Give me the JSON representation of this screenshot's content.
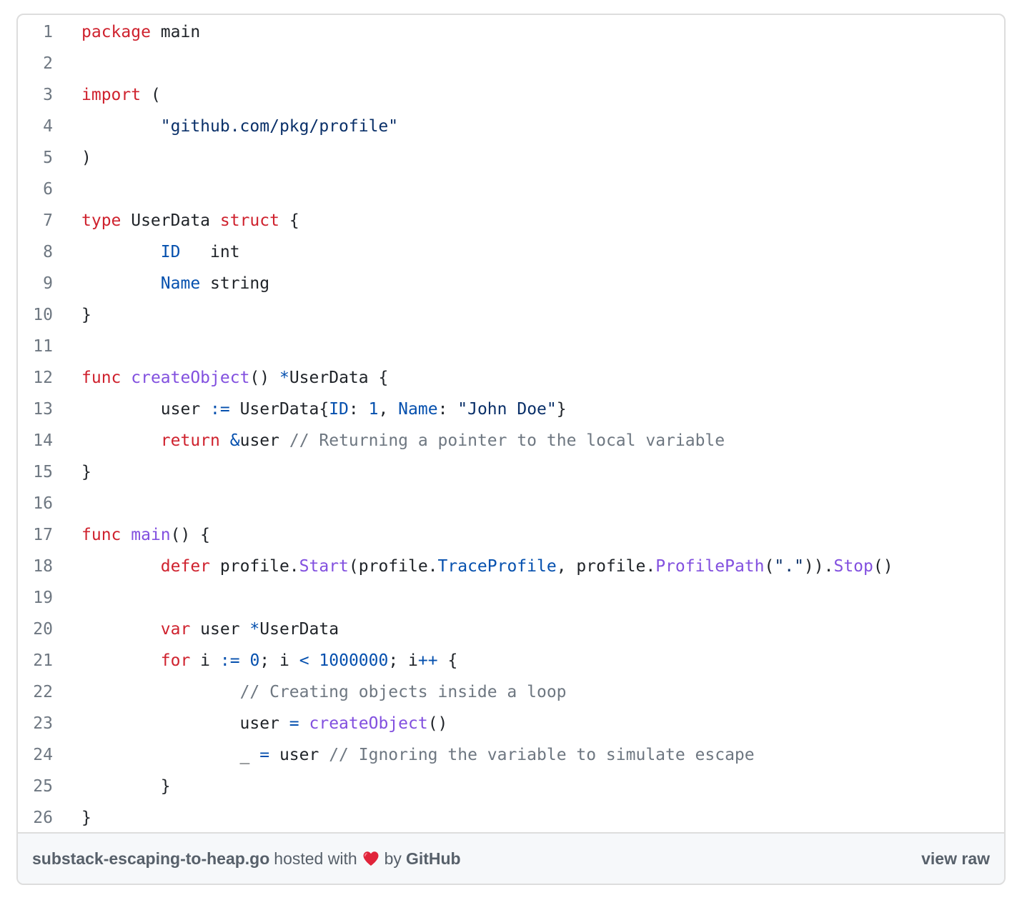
{
  "code": {
    "lines": [
      {
        "number": "1",
        "tokens": [
          {
            "t": "kw",
            "v": "package"
          },
          {
            "t": "tx",
            "v": " main"
          }
        ]
      },
      {
        "number": "2",
        "tokens": []
      },
      {
        "number": "3",
        "tokens": [
          {
            "t": "kw",
            "v": "import"
          },
          {
            "t": "tx",
            "v": " ("
          }
        ]
      },
      {
        "number": "4",
        "tokens": [
          {
            "t": "tx",
            "v": "        "
          },
          {
            "t": "st",
            "v": "\"github.com/pkg/profile\""
          }
        ]
      },
      {
        "number": "5",
        "tokens": [
          {
            "t": "tx",
            "v": ")"
          }
        ]
      },
      {
        "number": "6",
        "tokens": []
      },
      {
        "number": "7",
        "tokens": [
          {
            "t": "kw",
            "v": "type"
          },
          {
            "t": "tx",
            "v": " UserData "
          },
          {
            "t": "kw",
            "v": "struct"
          },
          {
            "t": "tx",
            "v": " {"
          }
        ]
      },
      {
        "number": "8",
        "tokens": [
          {
            "t": "tx",
            "v": "        "
          },
          {
            "t": "id",
            "v": "ID"
          },
          {
            "t": "tx",
            "v": "   int"
          }
        ]
      },
      {
        "number": "9",
        "tokens": [
          {
            "t": "tx",
            "v": "        "
          },
          {
            "t": "id",
            "v": "Name"
          },
          {
            "t": "tx",
            "v": " string"
          }
        ]
      },
      {
        "number": "10",
        "tokens": [
          {
            "t": "tx",
            "v": "}"
          }
        ]
      },
      {
        "number": "11",
        "tokens": []
      },
      {
        "number": "12",
        "tokens": [
          {
            "t": "kw",
            "v": "func"
          },
          {
            "t": "tx",
            "v": " "
          },
          {
            "t": "fn",
            "v": "createObject"
          },
          {
            "t": "tx",
            "v": "() "
          },
          {
            "t": "op",
            "v": "*"
          },
          {
            "t": "tx",
            "v": "UserData {"
          }
        ]
      },
      {
        "number": "13",
        "tokens": [
          {
            "t": "tx",
            "v": "        user "
          },
          {
            "t": "op",
            "v": ":="
          },
          {
            "t": "tx",
            "v": " UserData{"
          },
          {
            "t": "id",
            "v": "ID"
          },
          {
            "t": "tx",
            "v": ": "
          },
          {
            "t": "nm",
            "v": "1"
          },
          {
            "t": "tx",
            "v": ", "
          },
          {
            "t": "id",
            "v": "Name"
          },
          {
            "t": "tx",
            "v": ": "
          },
          {
            "t": "st",
            "v": "\"John Doe\""
          },
          {
            "t": "tx",
            "v": "}"
          }
        ]
      },
      {
        "number": "14",
        "tokens": [
          {
            "t": "tx",
            "v": "        "
          },
          {
            "t": "kw",
            "v": "return"
          },
          {
            "t": "tx",
            "v": " "
          },
          {
            "t": "op",
            "v": "&"
          },
          {
            "t": "tx",
            "v": "user "
          },
          {
            "t": "cm",
            "v": "// Returning a pointer to the local variable"
          }
        ]
      },
      {
        "number": "15",
        "tokens": [
          {
            "t": "tx",
            "v": "}"
          }
        ]
      },
      {
        "number": "16",
        "tokens": []
      },
      {
        "number": "17",
        "tokens": [
          {
            "t": "kw",
            "v": "func"
          },
          {
            "t": "tx",
            "v": " "
          },
          {
            "t": "fn",
            "v": "main"
          },
          {
            "t": "tx",
            "v": "() {"
          }
        ]
      },
      {
        "number": "18",
        "tokens": [
          {
            "t": "tx",
            "v": "        "
          },
          {
            "t": "kw",
            "v": "defer"
          },
          {
            "t": "tx",
            "v": " profile."
          },
          {
            "t": "fn",
            "v": "Start"
          },
          {
            "t": "tx",
            "v": "(profile."
          },
          {
            "t": "id",
            "v": "TraceProfile"
          },
          {
            "t": "tx",
            "v": ", profile."
          },
          {
            "t": "fn",
            "v": "ProfilePath"
          },
          {
            "t": "tx",
            "v": "("
          },
          {
            "t": "st",
            "v": "\".\""
          },
          {
            "t": "tx",
            "v": "))."
          },
          {
            "t": "fn",
            "v": "Stop"
          },
          {
            "t": "tx",
            "v": "()"
          }
        ]
      },
      {
        "number": "19",
        "tokens": []
      },
      {
        "number": "20",
        "tokens": [
          {
            "t": "tx",
            "v": "        "
          },
          {
            "t": "kw",
            "v": "var"
          },
          {
            "t": "tx",
            "v": " user "
          },
          {
            "t": "op",
            "v": "*"
          },
          {
            "t": "tx",
            "v": "UserData"
          }
        ]
      },
      {
        "number": "21",
        "tokens": [
          {
            "t": "tx",
            "v": "        "
          },
          {
            "t": "kw",
            "v": "for"
          },
          {
            "t": "tx",
            "v": " i "
          },
          {
            "t": "op",
            "v": ":="
          },
          {
            "t": "tx",
            "v": " "
          },
          {
            "t": "nm",
            "v": "0"
          },
          {
            "t": "tx",
            "v": "; i "
          },
          {
            "t": "op",
            "v": "<"
          },
          {
            "t": "tx",
            "v": " "
          },
          {
            "t": "nm",
            "v": "1000000"
          },
          {
            "t": "tx",
            "v": "; i"
          },
          {
            "t": "op",
            "v": "++"
          },
          {
            "t": "tx",
            "v": " {"
          }
        ]
      },
      {
        "number": "22",
        "tokens": [
          {
            "t": "tx",
            "v": "                "
          },
          {
            "t": "cm",
            "v": "// Creating objects inside a loop"
          }
        ]
      },
      {
        "number": "23",
        "tokens": [
          {
            "t": "tx",
            "v": "                user "
          },
          {
            "t": "op",
            "v": "="
          },
          {
            "t": "tx",
            "v": " "
          },
          {
            "t": "fn",
            "v": "createObject"
          },
          {
            "t": "tx",
            "v": "()"
          }
        ]
      },
      {
        "number": "24",
        "tokens": [
          {
            "t": "tx",
            "v": "                _ "
          },
          {
            "t": "op",
            "v": "="
          },
          {
            "t": "tx",
            "v": " user "
          },
          {
            "t": "cm",
            "v": "// Ignoring the variable to simulate escape"
          }
        ]
      },
      {
        "number": "25",
        "tokens": [
          {
            "t": "tx",
            "v": "        }"
          }
        ]
      },
      {
        "number": "26",
        "tokens": [
          {
            "t": "tx",
            "v": "}"
          }
        ]
      }
    ]
  },
  "footer": {
    "filename": "substack-escaping-to-heap.go",
    "hosted_with": "hosted with",
    "heart_icon": "heart-icon",
    "heart_color": "#e0243a",
    "by": "by",
    "host": "GitHub",
    "view_raw": "view raw"
  }
}
